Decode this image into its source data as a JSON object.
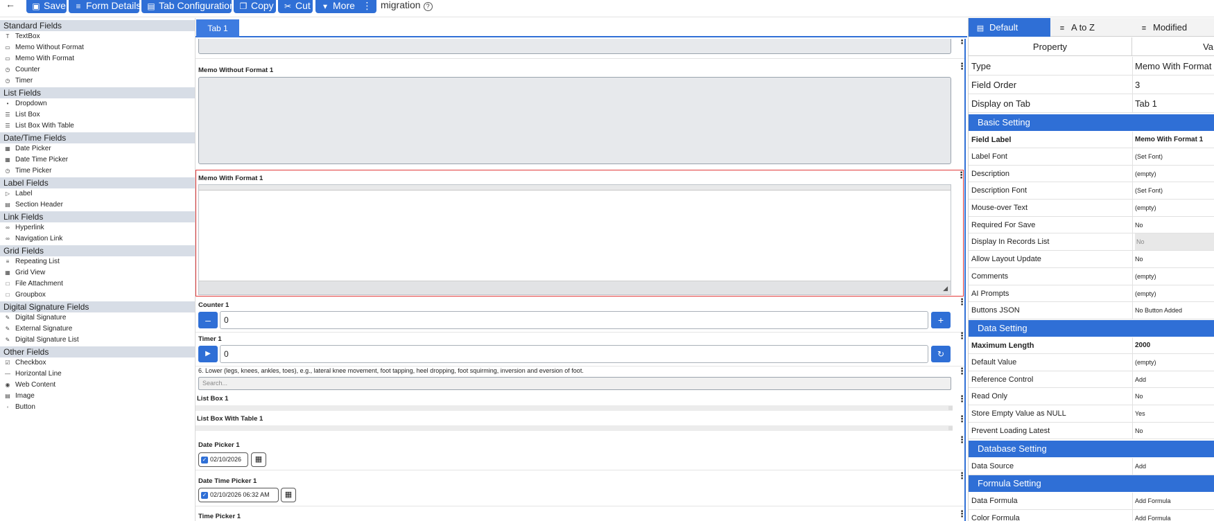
{
  "toolbar": {
    "save": "Save",
    "form_details": "Form Details",
    "tab_configuration": "Tab Configuration",
    "copy": "Copy",
    "cut": "Cut",
    "more": "More",
    "form_name": "migration"
  },
  "palette": {
    "standard_fields": "Standard Fields",
    "textbox": "TextBox",
    "memo_without_format": "Memo Without Format",
    "memo_with_format": "Memo With Format",
    "counter": "Counter",
    "timer": "Timer",
    "list_fields": "List Fields",
    "dropdown": "Dropdown",
    "list_box": "List Box",
    "list_box_with_table": "List Box With Table",
    "datetime_fields": "Date/Time Fields",
    "date_picker": "Date Picker",
    "date_time_picker": "Date Time Picker",
    "time_picker": "Time Picker",
    "label_fields": "Label Fields",
    "label": "Label",
    "section_header": "Section Header",
    "link_fields": "Link Fields",
    "hyperlink": "Hyperlink",
    "navigation_link": "Navigation Link",
    "grid_fields": "Grid Fields",
    "repeating_list": "Repeating List",
    "grid_view": "Grid View",
    "file_attachment": "File Attachment",
    "groupbox": "Groupbox",
    "digital_signature_fields": "Digital Signature Fields",
    "digital_signature": "Digital Signature",
    "external_signature": "External Signature",
    "digital_signature_list": "Digital Signature List",
    "other_fields": "Other Fields",
    "checkbox": "Checkbox",
    "horizontal_line": "Horizontal Line",
    "web_content": "Web Content",
    "image": "Image",
    "button": "Button"
  },
  "canvas": {
    "tab_label": "Tab 1",
    "memo_without_format_label": "Memo Without Format 1",
    "memo_with_format_label": "Memo With Format 1",
    "counter_label": "Counter 1",
    "counter_value": "0",
    "timer_label": "Timer 1",
    "timer_value": "0",
    "dropdown_label": "6. Lower (legs, knees, ankles, toes), e.g., lateral knee movement, foot tapping, heel dropping, foot squirming, inversion and eversion of foot.",
    "dropdown_placeholder": "Search...",
    "list_box_label": "List Box 1",
    "list_box_table_label": "List Box With Table 1",
    "date_picker_label": "Date Picker 1",
    "date_value": "02/10/2026",
    "date_time_picker_label": "Date Time Picker 1",
    "date_time_value": "02/10/2026 06:32 AM",
    "time_picker_label": "Time Picker 1"
  },
  "properties": {
    "tabs": {
      "default": "Default",
      "a_to_z": "A to Z",
      "modified": "Modified"
    },
    "col_property": "Property",
    "col_value": "Va",
    "type_k": "Type",
    "type_v": "Memo With Format",
    "field_order_k": "Field Order",
    "field_order_v": "3",
    "display_on_tab_k": "Display on Tab",
    "display_on_tab_v": "Tab 1",
    "basic_setting": "Basic Setting",
    "field_label_k": "Field Label",
    "field_label_v": "Memo With Format 1",
    "label_font_k": "Label Font",
    "label_font_v": "(Set Font)",
    "description_k": "Description",
    "description_v": "(empty)",
    "description_font_k": "Description Font",
    "description_font_v": "(Set Font)",
    "mouseover_k": "Mouse-over Text",
    "mouseover_v": "(empty)",
    "required_k": "Required For Save",
    "required_v": "No",
    "display_records_k": "Display In Records List",
    "display_records_v": "No",
    "allow_layout_k": "Allow Layout Update",
    "allow_layout_v": "No",
    "comments_k": "Comments",
    "comments_v": "(empty)",
    "ai_prompts_k": "AI Prompts",
    "ai_prompts_v": "(empty)",
    "buttons_json_k": "Buttons JSON",
    "buttons_json_v": "No Button Added",
    "data_setting": "Data Setting",
    "max_length_k": "Maximum Length",
    "max_length_v": "2000",
    "default_value_k": "Default Value",
    "default_value_v": "(empty)",
    "reference_control_k": "Reference Control",
    "reference_control_v": "Add",
    "read_only_k": "Read Only",
    "read_only_v": "No",
    "store_empty_k": "Store Empty Value as NULL",
    "store_empty_v": "Yes",
    "prevent_loading_k": "Prevent Loading Latest",
    "prevent_loading_v": "No",
    "database_setting": "Database Setting",
    "data_source_k": "Data Source",
    "data_source_v": "Add",
    "formula_setting": "Formula Setting",
    "data_formula_k": "Data Formula",
    "data_formula_v": "Add Formula",
    "color_formula_k": "Color Formula",
    "color_formula_v": "Add Formula"
  },
  "colors": {
    "accent": "#2f6fd6",
    "selected_border": "#e23a3a",
    "section_bg": "#d7dde6"
  }
}
